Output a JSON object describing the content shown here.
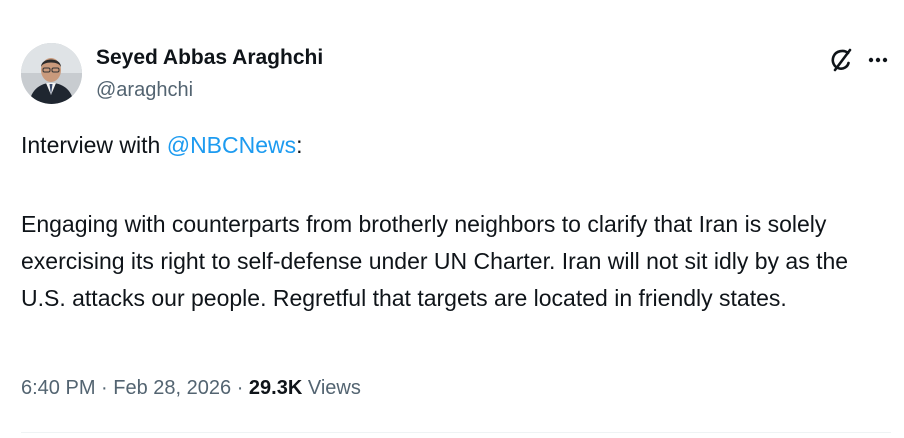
{
  "author": {
    "name": "Seyed Abbas Araghchi",
    "handle": "@araghchi"
  },
  "icons": {
    "grok": "grok-icon",
    "more": "more-dots-icon"
  },
  "tweet": {
    "intro_prefix": "Interview with ",
    "mention": "@NBCNews",
    "intro_suffix": ":",
    "body": "Engaging with counterparts from brotherly neighbors to clarify that Iran is solely exercising its right to self-defense under UN Charter. Iran will not sit idly by as the U.S. attacks our people. Regretful that targets are located in friendly states."
  },
  "meta": {
    "timestamp": "6:40 PM · Feb 28, 2026",
    "separator": " · ",
    "views_count": "29.3K",
    "views_label": " Views"
  },
  "colors": {
    "text": "#0f1419",
    "secondary": "#536471",
    "link": "#1d9bf0"
  }
}
